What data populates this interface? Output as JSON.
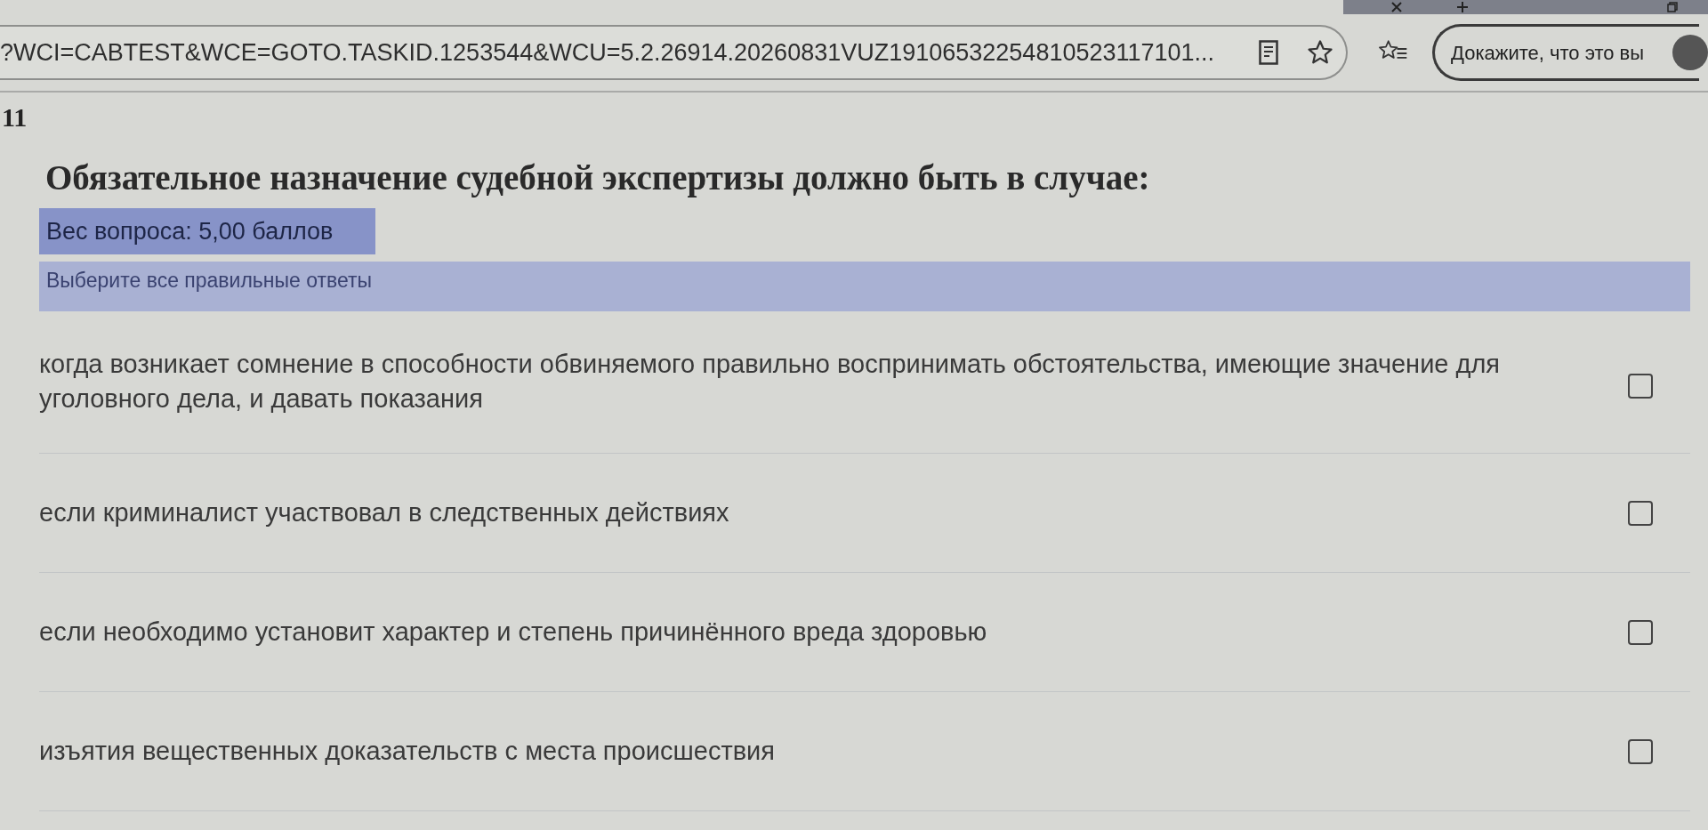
{
  "browser": {
    "url": "?WCI=CABTEST&WCE=GOTO.TASKID.1253544&WCU=5.2.26914.20260831VUZ19106532254810523117101...",
    "profile_button": "Докажите, что это вы"
  },
  "question": {
    "number": "11",
    "text": "Обязательное назначение судебной экспертизы должно быть в случае:",
    "weight": "Вес вопроса: 5,00 баллов",
    "instruction": "Выберите все правильные ответы",
    "answers": [
      {
        "text": "когда возникает сомнение в способности обвиняемого правильно воспринимать обстоятельства, имеющие значение для уголовного дела, и давать показания",
        "checked": false
      },
      {
        "text": "если криминалист участвовал в следственных действиях",
        "checked": false
      },
      {
        "text": "если необходимо установит характер и степень причинённого вреда здоровью",
        "checked": false
      },
      {
        "text": "изъятия вещественных доказательств с места происшествия",
        "checked": false
      }
    ]
  }
}
